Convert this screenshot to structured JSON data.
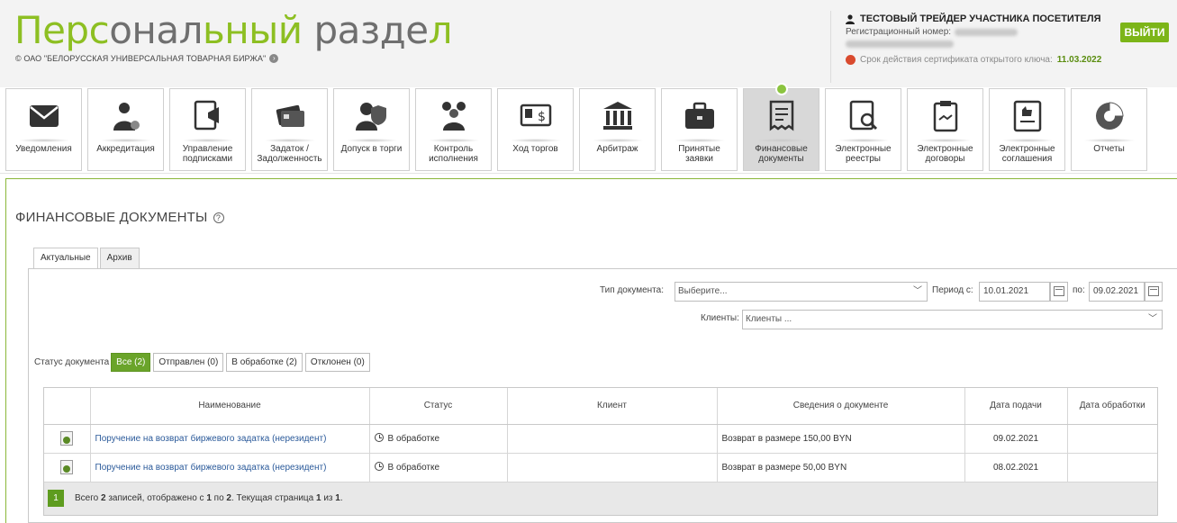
{
  "header": {
    "title_part1": "Перс",
    "title_part2": "онал",
    "title_part3": "ьный",
    "title_part4": " разде",
    "title_part5": "л",
    "subtitle": "© ОАО \"БЕЛОРУССКАЯ УНИВЕРСАЛЬНАЯ ТОВАРНАЯ БИРЖА\"",
    "user_name": "ТЕСТОВЫЙ ТРЕЙДЕР УЧАСТНИКА ПОСЕТИТЕЛЯ",
    "reg_label": "Регистрационный номер:",
    "cert_label": "Срок действия сертификата открытого ключа:",
    "cert_date": "11.03.2022",
    "logout": "ВЫЙТИ"
  },
  "nav": [
    {
      "label": "Уведомления",
      "icon": "envelope-icon"
    },
    {
      "label": "Аккредитация",
      "icon": "user-gear-icon"
    },
    {
      "label": "Управление\nподписками",
      "icon": "megaphone-icon"
    },
    {
      "label": "Задаток /\nЗадолженность",
      "icon": "cards-icon"
    },
    {
      "label": "Допуск в торги",
      "icon": "user-shield-icon"
    },
    {
      "label": "Контроль\nисполнения",
      "icon": "team-icon"
    },
    {
      "label": "Ход торгов",
      "icon": "monitor-dollar-icon"
    },
    {
      "label": "Арбитраж",
      "icon": "courthouse-icon"
    },
    {
      "label": "Принятые\nзаявки",
      "icon": "briefcase-icon"
    },
    {
      "label": "Финансовые\nдокументы",
      "icon": "receipt-icon"
    },
    {
      "label": "Электронные\nреестры",
      "icon": "registry-icon"
    },
    {
      "label": "Электронные\nдоговоры",
      "icon": "contract-icon"
    },
    {
      "label": "Электронные\nсоглашения",
      "icon": "agreement-icon"
    },
    {
      "label": "Отчеты",
      "icon": "pie-chart-icon"
    }
  ],
  "colors": {
    "brand_green": "#8dbf22",
    "active_green": "#6aa42a"
  },
  "page": {
    "title": "ФИНАНСОВЫЕ ДОКУМЕНТЫ",
    "help": "?"
  },
  "tabs": {
    "current": "Актуальные",
    "archive": "Архив"
  },
  "filters": {
    "doc_type_label": "Тип документа:",
    "doc_type_value": "Выберите...",
    "period_from_label": "Период с:",
    "period_from": "10.01.2021",
    "period_to_label": "по:",
    "period_to": "09.02.2021",
    "clients_label": "Клиенты:",
    "clients_value": "Клиенты ..."
  },
  "status": {
    "label": "Статус документа",
    "buttons": [
      "Все (2)",
      "Отправлен (0)",
      "В обработке (2)",
      "Отклонен (0)"
    ]
  },
  "table": {
    "headers": {
      "name": "Наименование",
      "status": "Статус",
      "client": "Клиент",
      "info": "Сведения о документе",
      "submit_date": "Дата подачи",
      "process_date": "Дата обработки"
    },
    "rows": [
      {
        "name": "Поручение на возврат биржевого задатка (нерезидент)",
        "status": "В обработке",
        "client": "",
        "info": "Возврат в размере 150,00 BYN",
        "submit_date": "09.02.2021",
        "process_date": ""
      },
      {
        "name": "Поручение на возврат биржевого задатка (нерезидент)",
        "status": "В обработке",
        "client": "",
        "info": "Возврат в размере 50,00 BYN",
        "submit_date": "08.02.2021",
        "process_date": ""
      }
    ]
  },
  "pager": {
    "page": "1",
    "t1": "Всего ",
    "total": "2",
    "t2": " записей, отображено с ",
    "from": "1",
    "t3": " по ",
    "to": "2",
    "t4": ". Текущая страница ",
    "cur": "1",
    "t5": " из ",
    "pages": "1",
    "t6": "."
  }
}
